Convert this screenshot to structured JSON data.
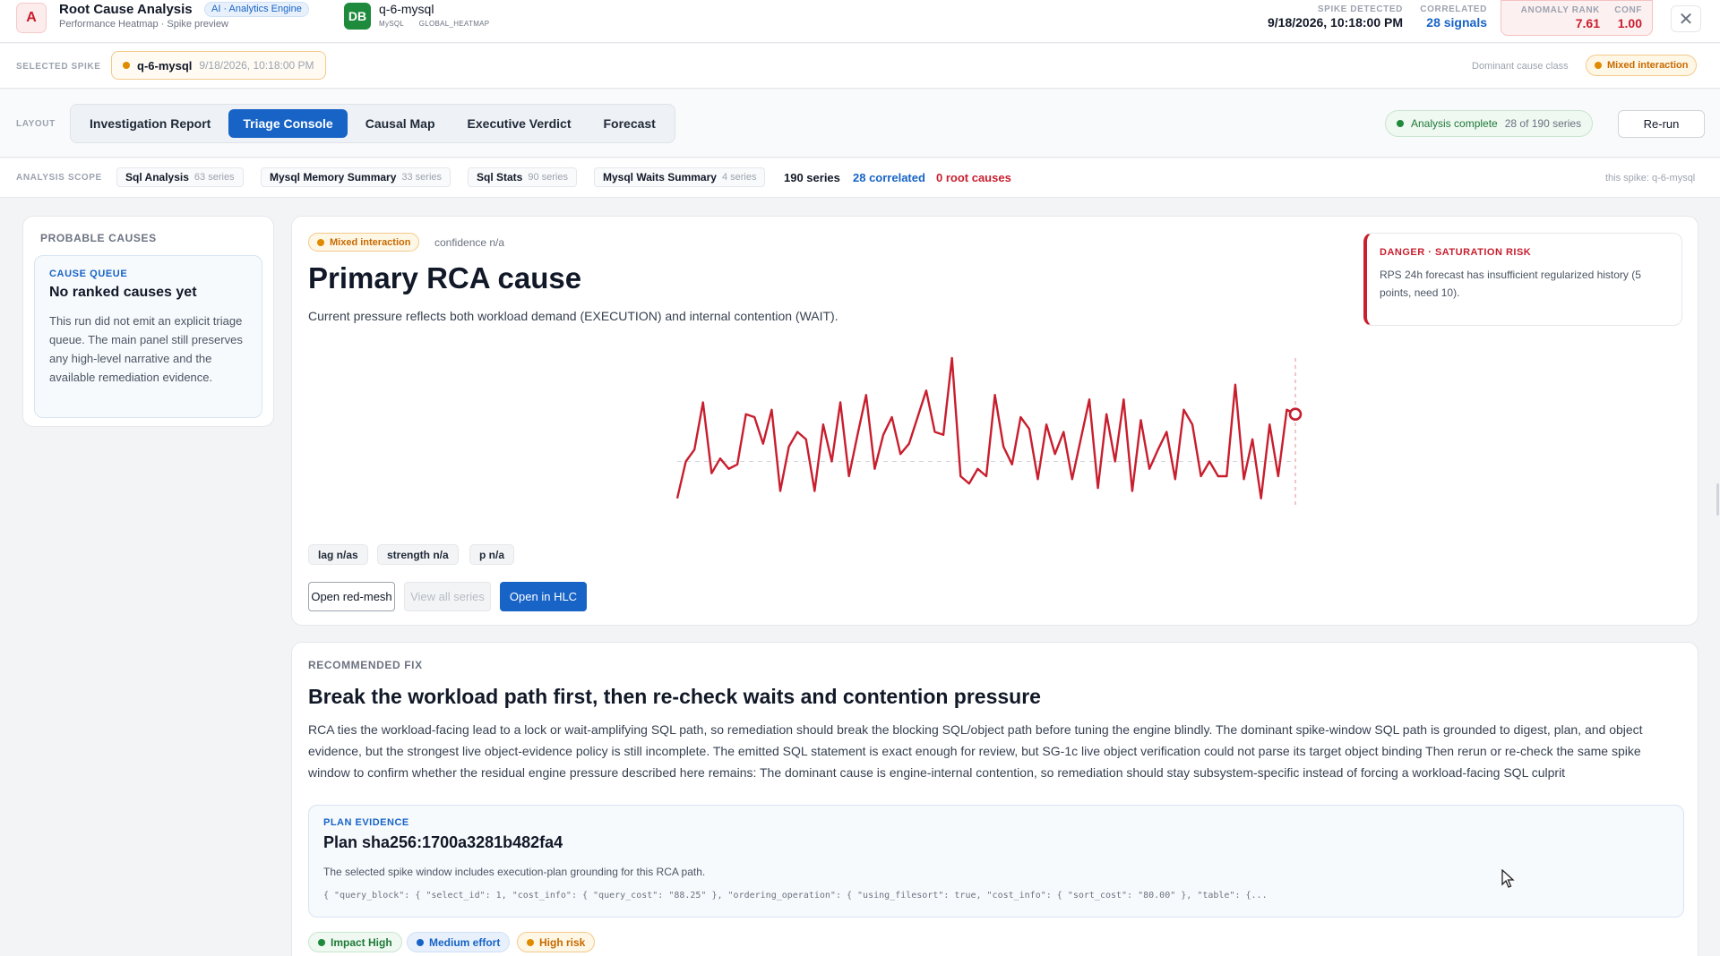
{
  "header": {
    "logo_glyph": "A",
    "title": "Root Cause Analysis",
    "badge": "AI · Analytics Engine",
    "subtitle": "Performance Heatmap · Spike preview",
    "db_glyph": "DB",
    "db_name": "q-6-mysql",
    "db_engine": "MySQL",
    "db_scope": "GLOBAL_HEATMAP",
    "spike_detected_label": "SPIKE DETECTED",
    "spike_detected_value": "9/18/2026, 10:18:00 PM",
    "correlated_label": "CORRELATED",
    "correlated_value": "28 signals",
    "anomaly_rank_label": "ANOMALY RANK",
    "anomaly_rank_value": "7.61",
    "conf_label": "CONF",
    "conf_value": "1.00",
    "close_glyph": "✕"
  },
  "spike": {
    "label": "SELECTED SPIKE",
    "name": "q-6-mysql",
    "timestamp": "9/18/2026, 10:18:00 PM",
    "dominant_label": "Dominant cause class",
    "dominant_value": "Mixed interaction"
  },
  "layout": {
    "label": "LAYOUT",
    "tabs": [
      "Investigation Report",
      "Triage Console",
      "Causal Map",
      "Executive Verdict",
      "Forecast"
    ],
    "active_tab": "Triage Console",
    "status": "Analysis complete",
    "status_sub": "28 of 190 series",
    "rerun": "Re-run"
  },
  "scope": {
    "label": "ANALYSIS SCOPE",
    "chips": [
      {
        "name": "Sql Analysis",
        "count": "63 series"
      },
      {
        "name": "Mysql Memory Summary",
        "count": "33 series"
      },
      {
        "name": "Sql Stats",
        "count": "90 series"
      },
      {
        "name": "Mysql Waits Summary",
        "count": "4 series"
      }
    ],
    "total": "190 series",
    "correlated": "28 correlated",
    "root_causes": "0 root causes",
    "right_note": "this spike: q-6-mysql"
  },
  "probable_causes": {
    "title": "PROBABLE CAUSES",
    "queue_label": "CAUSE QUEUE",
    "queue_title": "No ranked causes yet",
    "queue_body": "This run did not emit an explicit triage queue. The main panel still preserves any high-level narrative and the available remediation evidence."
  },
  "primary": {
    "pill": "Mixed interaction",
    "confidence": "confidence n/a",
    "title": "Primary RCA cause",
    "description": "Current pressure reflects both workload demand (EXECUTION) and internal contention (WAIT).",
    "metrics": [
      "lag n/as",
      "strength n/a",
      "p n/a"
    ],
    "buttons": {
      "open_mesh": "Open red-mesh",
      "view_all": "View all series",
      "open_hlc": "Open in HLC"
    },
    "danger_title": "DANGER · SATURATION RISK",
    "danger_body": "RPS 24h forecast has insufficient regularized history (5 points, need 10)."
  },
  "chart_data": {
    "type": "line",
    "series": [
      {
        "values": [
          0.05,
          0.3,
          0.38,
          0.7,
          0.22,
          0.32,
          0.25,
          0.28,
          0.62,
          0.6,
          0.42,
          0.65,
          0.1,
          0.4,
          0.5,
          0.45,
          0.1,
          0.55,
          0.3,
          0.7,
          0.2,
          0.48,
          0.75,
          0.25,
          0.48,
          0.6,
          0.35,
          0.42,
          0.6,
          0.78,
          0.5,
          0.48,
          1.0,
          0.2,
          0.15,
          0.25,
          0.2,
          0.75,
          0.4,
          0.28,
          0.6,
          0.52,
          0.18,
          0.55,
          0.35,
          0.5,
          0.18,
          0.45,
          0.72,
          0.12,
          0.62,
          0.3,
          0.72,
          0.1,
          0.58,
          0.25,
          0.38,
          0.5,
          0.18,
          0.65,
          0.55,
          0.2,
          0.3,
          0.2,
          0.2,
          0.82,
          0.18,
          0.45,
          0.05,
          0.55,
          0.2,
          0.65,
          0.62
        ]
      }
    ],
    "baseline": 0.3,
    "spike_index": 72,
    "colors": {
      "line": "#c81e2e",
      "baseline": "#d1d5db",
      "marker": "#c81e2e"
    }
  },
  "fix": {
    "label": "RECOMMENDED FIX",
    "title": "Break the workload path first, then re-check waits and contention pressure",
    "body": "RCA ties the workload-facing lead to a lock or wait-amplifying SQL path, so remediation should break the blocking SQL/object path before tuning the engine blindly. The dominant spike-window SQL path is grounded to digest, plan, and object evidence, but the strongest live object-evidence policy is still incomplete. The emitted SQL statement is exact enough for review, but SG-1c live object verification could not parse its target object binding Then rerun or re-check the same spike window to confirm whether the residual engine pressure described here remains: The dominant cause is engine-internal contention, so remediation should stay subsystem-specific instead of forcing a workload-facing SQL culprit",
    "plan_label": "PLAN EVIDENCE",
    "plan_title": "Plan sha256:1700a3281b482fa4",
    "plan_desc": "The selected spike window includes execution-plan grounding for this RCA path.",
    "plan_code": "{ \"query_block\": { \"select_id\": 1, \"cost_info\": { \"query_cost\": \"88.25\" }, \"ordering_operation\": { \"using_filesort\": true, \"cost_info\": { \"sort_cost\": \"80.00\" }, \"table\": {...",
    "tags": [
      "Impact High",
      "Medium effort",
      "High risk"
    ]
  },
  "colors": {
    "accent": "#1763c6",
    "danger": "#c81e2e",
    "success": "#1e7a37",
    "warning": "#e08a00"
  }
}
